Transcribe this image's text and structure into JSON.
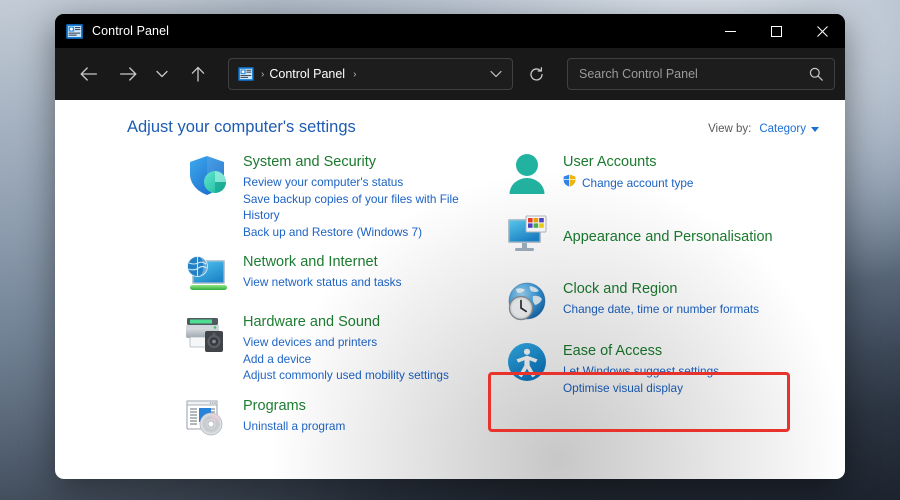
{
  "window": {
    "title": "Control Panel",
    "icon": "control-panel-icon",
    "controls": {
      "minimize": "minimize-icon",
      "maximize": "maximize-icon",
      "close": "close-icon"
    }
  },
  "toolbar": {
    "back": "back-arrow-icon",
    "forward": "forward-arrow-icon",
    "recent": "chevron-down-icon",
    "up": "up-arrow-icon",
    "address": {
      "icon": "control-panel-icon",
      "separator": "›",
      "crumb": "Control Panel",
      "separator2": "›",
      "dropdown": "chevron-down-icon"
    },
    "refresh": "refresh-icon",
    "search": {
      "placeholder": "Search Control Panel",
      "value": "",
      "icon": "search-icon"
    }
  },
  "page": {
    "title": "Adjust your computer's settings",
    "view_by": {
      "label": "View by:",
      "value": "Category",
      "caret": "chevron-down-icon"
    }
  },
  "highlight": {
    "color": "#e8332c",
    "target": "Clock and Region"
  },
  "categories": {
    "left": [
      {
        "id": "system-and-security",
        "icon": "shield-icon",
        "title": "System and Security",
        "links": [
          "Review your computer's status",
          "Save backup copies of your files with File History",
          "Back up and Restore (Windows 7)"
        ]
      },
      {
        "id": "network-and-internet",
        "icon": "network-monitor-icon",
        "title": "Network and Internet",
        "links": [
          "View network status and tasks"
        ]
      },
      {
        "id": "hardware-and-sound",
        "icon": "printer-speaker-icon",
        "title": "Hardware and Sound",
        "links": [
          "View devices and printers",
          "Add a device",
          "Adjust commonly used mobility settings"
        ]
      },
      {
        "id": "programs",
        "icon": "programs-disc-icon",
        "title": "Programs",
        "links": [
          "Uninstall a program"
        ]
      }
    ],
    "right": [
      {
        "id": "user-accounts",
        "icon": "user-person-icon",
        "title": "User Accounts",
        "links": [
          "Change account type"
        ],
        "shield_on_first_link": true
      },
      {
        "id": "appearance-and-personalisation",
        "icon": "monitor-colors-icon",
        "title": "Appearance and Personalisation",
        "links": []
      },
      {
        "id": "clock-and-region",
        "icon": "globe-clock-icon",
        "title": "Clock and Region",
        "links": [
          "Change date, time or number formats"
        ]
      },
      {
        "id": "ease-of-access",
        "icon": "accessibility-icon",
        "title": "Ease of Access",
        "links": [
          "Let Windows suggest settings",
          "Optimise visual display"
        ]
      }
    ]
  },
  "colors": {
    "title_link": "#1a7a2e",
    "sub_link": "#1b62c4",
    "page_title": "#1e5cb3",
    "highlight": "#e8332c",
    "window_chrome": "#191919"
  }
}
